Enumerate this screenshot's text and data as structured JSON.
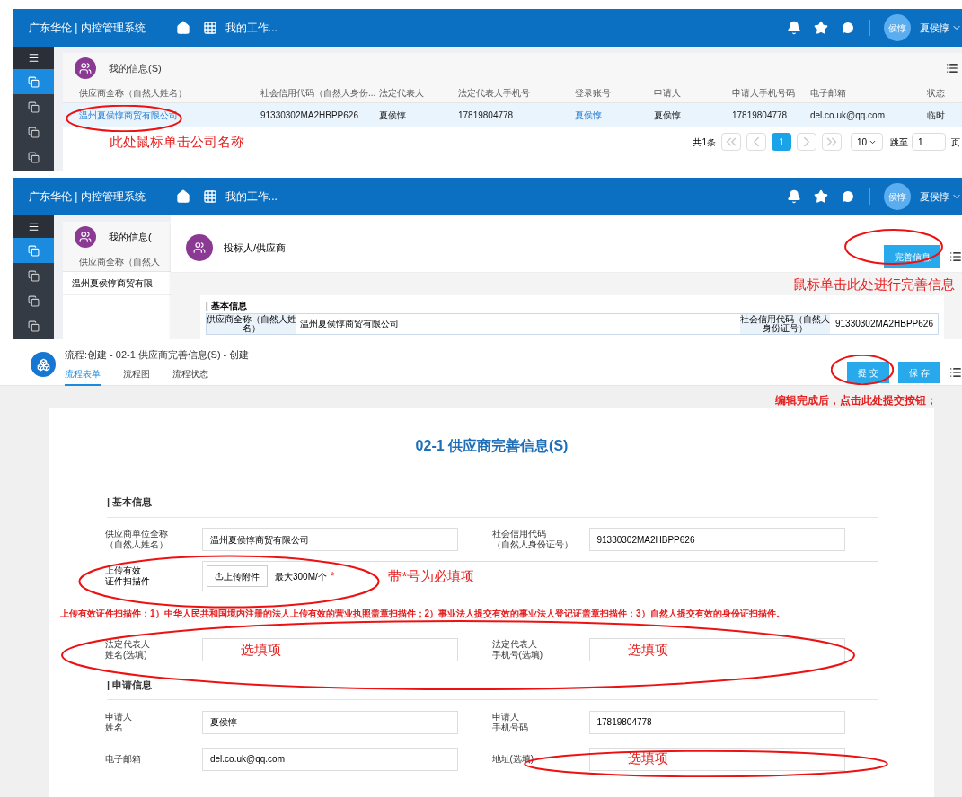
{
  "headers": [
    {
      "brand": "广东华伦 | 内控管理系统",
      "nav": "我的工作...",
      "avatar": "侯惇",
      "user": "夏侯惇"
    },
    {
      "brand": "广东华伦 | 内控管理系统",
      "nav": "我的工作...",
      "avatar": "侯惇",
      "user": "夏侯惇"
    }
  ],
  "list_screen": {
    "card_title": "我的信息(S)",
    "columns": [
      "供应商全称（自然人姓名）",
      "社会信用代码（自然人身份...",
      "法定代表人",
      "法定代表人手机号",
      "登录账号",
      "申请人",
      "申请人手机号码",
      "电子邮箱",
      "状态"
    ],
    "rows": [
      {
        "selected": true,
        "cells": [
          {
            "text": "温州夏侯惇商贸有限公司",
            "kind": "link"
          },
          {
            "text": "91330302MA2HBPP626",
            "kind": "text"
          },
          {
            "text": "夏侯惇",
            "kind": "text"
          },
          {
            "text": "17819804778",
            "kind": "text"
          },
          {
            "text": "夏侯惇",
            "kind": "link"
          },
          {
            "text": "夏侯惇",
            "kind": "text"
          },
          {
            "text": "17819804778",
            "kind": "text"
          },
          {
            "text": "del.co.uk@qq.com",
            "kind": "text"
          },
          {
            "text": "临时",
            "kind": "text"
          }
        ]
      }
    ],
    "pagination": {
      "total": "共1条",
      "pages": [
        {
          "label": "1",
          "selected": true
        }
      ],
      "page_size": "10",
      "jump_label": "跳至",
      "jump_value": "1",
      "page_unit": "页"
    },
    "annotation": "此处鼠标单击公司名称"
  },
  "detail_screen": {
    "card_title": "我的信息(",
    "column": "供应商全称（自然人",
    "row": "温州夏侯惇商贸有限",
    "modal_title": "投标人/供应商",
    "button": "完善信息",
    "annotation": "鼠标单击此处进行完善信息",
    "section": "| 基本信息",
    "fields": [
      {
        "label": "供应商全称（自然人姓名）",
        "value": "温州夏侯惇商贸有限公司"
      },
      {
        "label": "社会信用代码（自然人身份证号）",
        "value": "91330302MA2HBPP626"
      }
    ]
  },
  "form_screen": {
    "title": "流程:创建 - 02-1 供应商完善信息(S) - 创建",
    "tabs": [
      {
        "label": "流程表单",
        "selected": true
      },
      {
        "label": "流程图",
        "selected": false
      },
      {
        "label": "流程状态",
        "selected": false
      }
    ],
    "buttons": [
      "提 交",
      "保 存"
    ],
    "annotation": "编辑完成后，点击此处提交按钮；",
    "form_title": "02-1 供应商完善信息(S)",
    "sections": [
      {
        "title": "| 基本信息",
        "rows": [
          [
            {
              "label": [
                "供应商单位全称",
                "（自然人姓名）"
              ],
              "kind": "input",
              "value": "温州夏侯惇商贸有限公司"
            },
            {
              "label": [
                "社会信用代码",
                "（自然人身份证号）"
              ],
              "kind": "input",
              "value": "91330302MA2HBPP626"
            }
          ],
          [
            {
              "label": [
                "上传有效",
                "证件扫描件"
              ],
              "kind": "upload",
              "button": "上传附件",
              "hint": "最大300M/个",
              "required": true,
              "required_mark": "*",
              "annotation": "带*号为必填项"
            }
          ],
          [
            {
              "kind": "note",
              "text": "上传有效证件扫描件：1）中华人民共和国境内注册的法人上传有效的营业执照盖章扫描件；2）事业法人提交有效的事业法人登记证盖章扫描件；3）自然人提交有效的身份证扫描件。"
            }
          ],
          [
            {
              "label": [
                "法定代表人",
                "姓名(选填)"
              ],
              "kind": "input",
              "annotation": "选填项"
            },
            {
              "label": [
                "法定代表人",
                "手机号(选填)"
              ],
              "kind": "input",
              "annotation": "选填项"
            }
          ]
        ]
      },
      {
        "title": "| 申请信息",
        "rows": [
          [
            {
              "label": [
                "申请人",
                "姓名"
              ],
              "kind": "input",
              "value": "夏侯惇"
            },
            {
              "label": [
                "申请人",
                "手机号码"
              ],
              "kind": "input",
              "value": "17819804778"
            }
          ],
          [
            {
              "label": [
                "电子邮箱"
              ],
              "kind": "input",
              "value": "del.co.uk@qq.com"
            },
            {
              "label": [
                "地址(选填)"
              ],
              "kind": "input",
              "annotation": "选填项"
            }
          ]
        ]
      }
    ]
  }
}
